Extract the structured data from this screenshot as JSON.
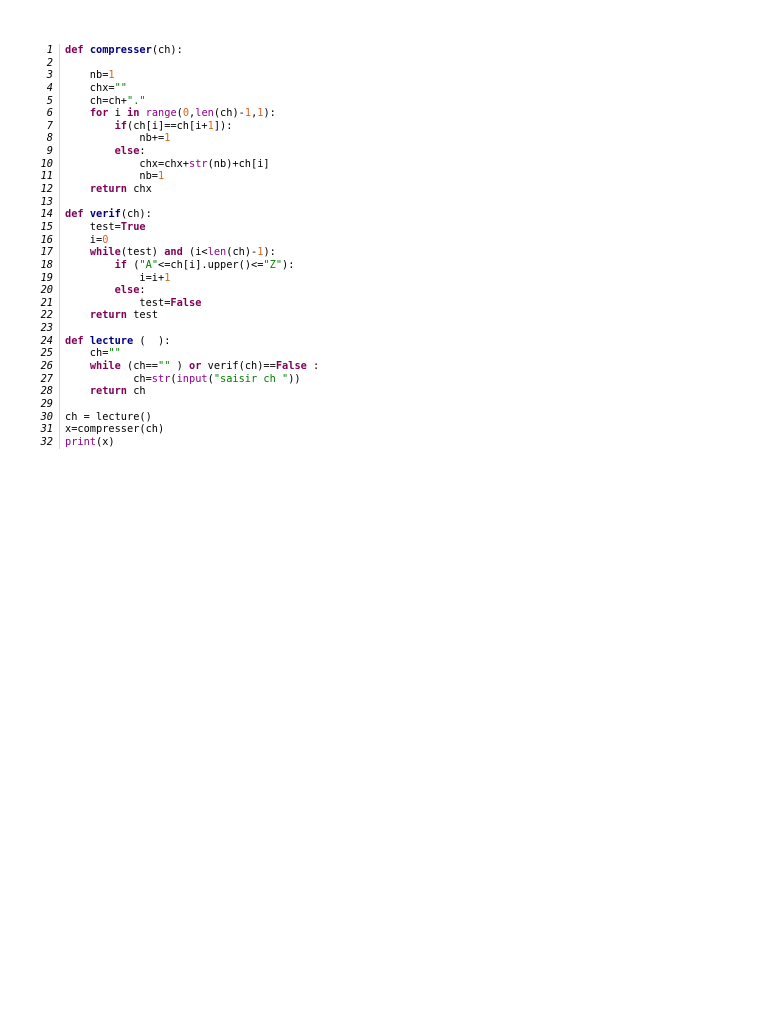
{
  "colors": {
    "keyword": "#7f0055",
    "function_name": "#000080",
    "number": "#d2691e",
    "string": "#008000",
    "builtin": "#900090",
    "plain": "#000000"
  },
  "lines": [
    {
      "n": "1",
      "tokens": [
        [
          "kw",
          "def"
        ],
        [
          "plain",
          " "
        ],
        [
          "fn",
          "compresser"
        ],
        [
          "plain",
          "(ch):"
        ]
      ]
    },
    {
      "n": "2",
      "tokens": []
    },
    {
      "n": "3",
      "tokens": [
        [
          "plain",
          "    nb="
        ],
        [
          "num",
          "1"
        ]
      ]
    },
    {
      "n": "4",
      "tokens": [
        [
          "plain",
          "    chx="
        ],
        [
          "str",
          "\"\""
        ]
      ]
    },
    {
      "n": "5",
      "tokens": [
        [
          "plain",
          "    ch=ch+"
        ],
        [
          "str",
          "\".\""
        ]
      ]
    },
    {
      "n": "6",
      "tokens": [
        [
          "plain",
          "    "
        ],
        [
          "kw",
          "for"
        ],
        [
          "plain",
          " i "
        ],
        [
          "kw",
          "in"
        ],
        [
          "plain",
          " "
        ],
        [
          "bi",
          "range"
        ],
        [
          "plain",
          "("
        ],
        [
          "num",
          "0"
        ],
        [
          "plain",
          ","
        ],
        [
          "bi",
          "len"
        ],
        [
          "plain",
          "(ch)-"
        ],
        [
          "num",
          "1"
        ],
        [
          "plain",
          ","
        ],
        [
          "num",
          "1"
        ],
        [
          "plain",
          "):"
        ]
      ]
    },
    {
      "n": "7",
      "tokens": [
        [
          "plain",
          "        "
        ],
        [
          "kw",
          "if"
        ],
        [
          "plain",
          "(ch[i]==ch[i+"
        ],
        [
          "num",
          "1"
        ],
        [
          "plain",
          "]):"
        ]
      ]
    },
    {
      "n": "8",
      "tokens": [
        [
          "plain",
          "            nb+="
        ],
        [
          "num",
          "1"
        ]
      ]
    },
    {
      "n": "9",
      "tokens": [
        [
          "plain",
          "        "
        ],
        [
          "kw",
          "else"
        ],
        [
          "plain",
          ":"
        ]
      ]
    },
    {
      "n": "10",
      "tokens": [
        [
          "plain",
          "            chx=chx+"
        ],
        [
          "bi",
          "str"
        ],
        [
          "plain",
          "(nb)+ch[i]"
        ]
      ]
    },
    {
      "n": "11",
      "tokens": [
        [
          "plain",
          "            nb="
        ],
        [
          "num",
          "1"
        ]
      ]
    },
    {
      "n": "12",
      "tokens": [
        [
          "plain",
          "    "
        ],
        [
          "kw",
          "return"
        ],
        [
          "plain",
          " chx"
        ]
      ]
    },
    {
      "n": "13",
      "tokens": []
    },
    {
      "n": "14",
      "tokens": [
        [
          "kw",
          "def"
        ],
        [
          "plain",
          " "
        ],
        [
          "fn",
          "verif"
        ],
        [
          "plain",
          "(ch):"
        ]
      ]
    },
    {
      "n": "15",
      "tokens": [
        [
          "plain",
          "    test="
        ],
        [
          "kw",
          "True"
        ]
      ]
    },
    {
      "n": "16",
      "tokens": [
        [
          "plain",
          "    i="
        ],
        [
          "num",
          "0"
        ]
      ]
    },
    {
      "n": "17",
      "tokens": [
        [
          "plain",
          "    "
        ],
        [
          "kw",
          "while"
        ],
        [
          "plain",
          "(test) "
        ],
        [
          "kw",
          "and"
        ],
        [
          "plain",
          " (i<"
        ],
        [
          "bi",
          "len"
        ],
        [
          "plain",
          "(ch)-"
        ],
        [
          "num",
          "1"
        ],
        [
          "plain",
          "):"
        ]
      ]
    },
    {
      "n": "18",
      "tokens": [
        [
          "plain",
          "        "
        ],
        [
          "kw",
          "if"
        ],
        [
          "plain",
          " ("
        ],
        [
          "str",
          "\"A\""
        ],
        [
          "plain",
          "<=ch[i].upper()<="
        ],
        [
          "str",
          "\"Z\""
        ],
        [
          "plain",
          "):"
        ]
      ]
    },
    {
      "n": "19",
      "tokens": [
        [
          "plain",
          "            i=i+"
        ],
        [
          "num",
          "1"
        ]
      ]
    },
    {
      "n": "20",
      "tokens": [
        [
          "plain",
          "        "
        ],
        [
          "kw",
          "else"
        ],
        [
          "plain",
          ":"
        ]
      ]
    },
    {
      "n": "21",
      "tokens": [
        [
          "plain",
          "            test="
        ],
        [
          "kw",
          "False"
        ]
      ]
    },
    {
      "n": "22",
      "tokens": [
        [
          "plain",
          "    "
        ],
        [
          "kw",
          "return"
        ],
        [
          "plain",
          " test"
        ]
      ]
    },
    {
      "n": "23",
      "tokens": []
    },
    {
      "n": "24",
      "tokens": [
        [
          "kw",
          "def"
        ],
        [
          "plain",
          " "
        ],
        [
          "fn",
          "lecture"
        ],
        [
          "plain",
          " (  ):"
        ]
      ]
    },
    {
      "n": "25",
      "tokens": [
        [
          "plain",
          "    ch="
        ],
        [
          "str",
          "\"\""
        ]
      ]
    },
    {
      "n": "26",
      "tokens": [
        [
          "plain",
          "    "
        ],
        [
          "kw",
          "while"
        ],
        [
          "plain",
          " (ch=="
        ],
        [
          "str",
          "\"\""
        ],
        [
          "plain",
          " ) "
        ],
        [
          "kw",
          "or"
        ],
        [
          "plain",
          " verif(ch)=="
        ],
        [
          "kw",
          "False"
        ],
        [
          "plain",
          " :"
        ]
      ]
    },
    {
      "n": "27",
      "tokens": [
        [
          "plain",
          "           ch="
        ],
        [
          "bi",
          "str"
        ],
        [
          "plain",
          "("
        ],
        [
          "bi",
          "input"
        ],
        [
          "plain",
          "("
        ],
        [
          "str",
          "\"saisir ch \""
        ],
        [
          "plain",
          "))"
        ]
      ]
    },
    {
      "n": "28",
      "tokens": [
        [
          "plain",
          "    "
        ],
        [
          "kw",
          "return"
        ],
        [
          "plain",
          " ch"
        ]
      ]
    },
    {
      "n": "29",
      "tokens": []
    },
    {
      "n": "30",
      "tokens": [
        [
          "plain",
          "ch = lecture()"
        ]
      ]
    },
    {
      "n": "31",
      "tokens": [
        [
          "plain",
          "x=compresser(ch)"
        ]
      ]
    },
    {
      "n": "32",
      "tokens": [
        [
          "bi",
          "print"
        ],
        [
          "plain",
          "(x)"
        ]
      ]
    }
  ]
}
